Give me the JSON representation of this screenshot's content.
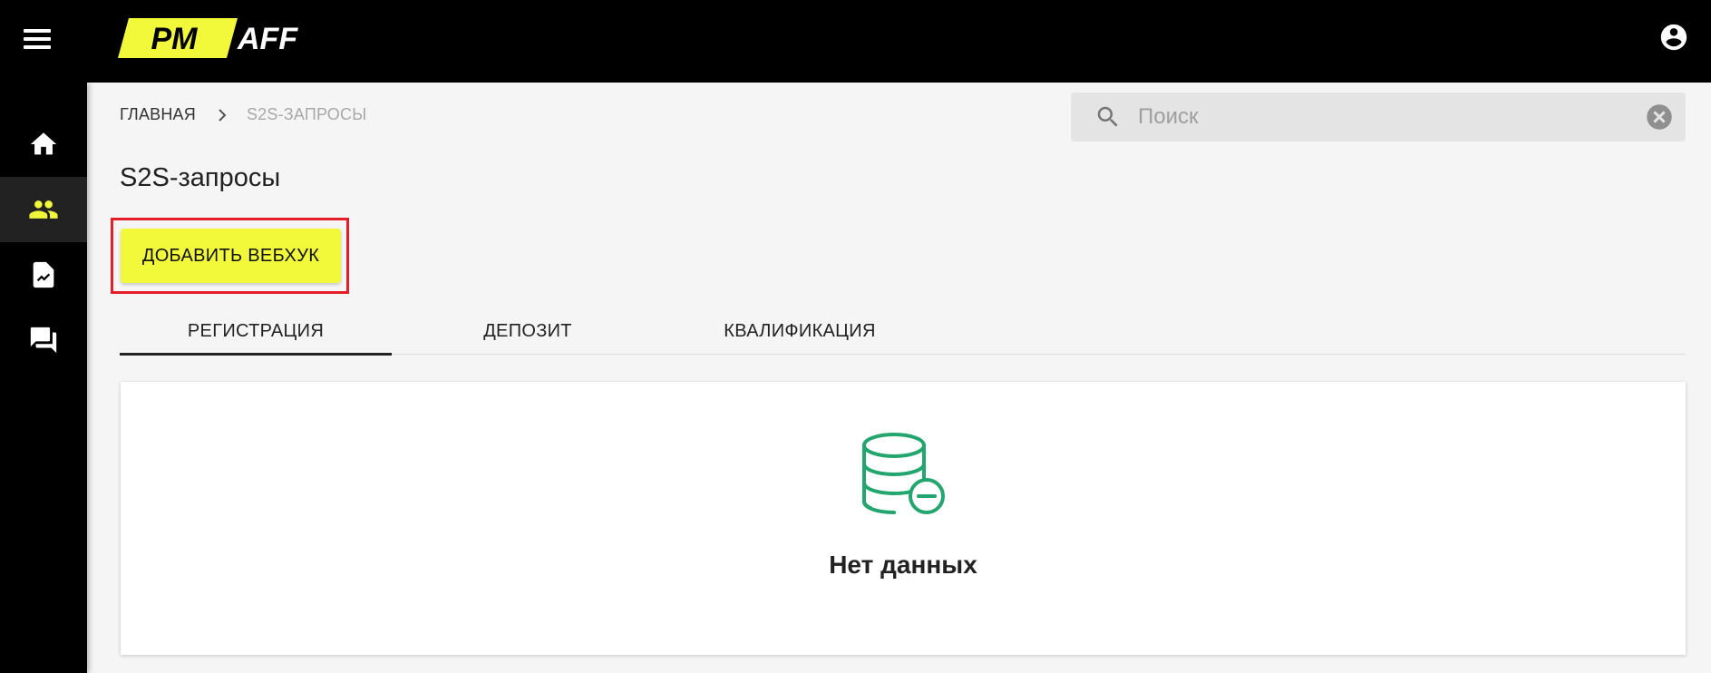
{
  "header": {
    "logo_text_left": "PM",
    "logo_text_right": "AFF",
    "colors": {
      "background": "#000000",
      "accent": "#F2F93B"
    }
  },
  "sidebar": {
    "items": [
      {
        "icon": "home-icon",
        "active": false
      },
      {
        "icon": "people-icon",
        "active": true
      },
      {
        "icon": "document-chart-icon",
        "active": false
      },
      {
        "icon": "forum-icon",
        "active": false
      }
    ]
  },
  "breadcrumb": {
    "home": "ГЛАВНАЯ",
    "current": "S2S-ЗАПРОСЫ"
  },
  "search": {
    "placeholder": "Поиск",
    "value": ""
  },
  "page": {
    "title": "S2S-запросы",
    "add_button": "ДОБАВИТЬ ВЕБХУК"
  },
  "tabs": [
    {
      "label": "РЕГИСТРАЦИЯ",
      "active": true
    },
    {
      "label": "ДЕПОЗИТ",
      "active": false
    },
    {
      "label": "КВАЛИФИКАЦИЯ",
      "active": false
    }
  ],
  "empty_state": {
    "text": "Нет данных",
    "icon": "database-remove-icon",
    "icon_color": "#22A66E"
  }
}
